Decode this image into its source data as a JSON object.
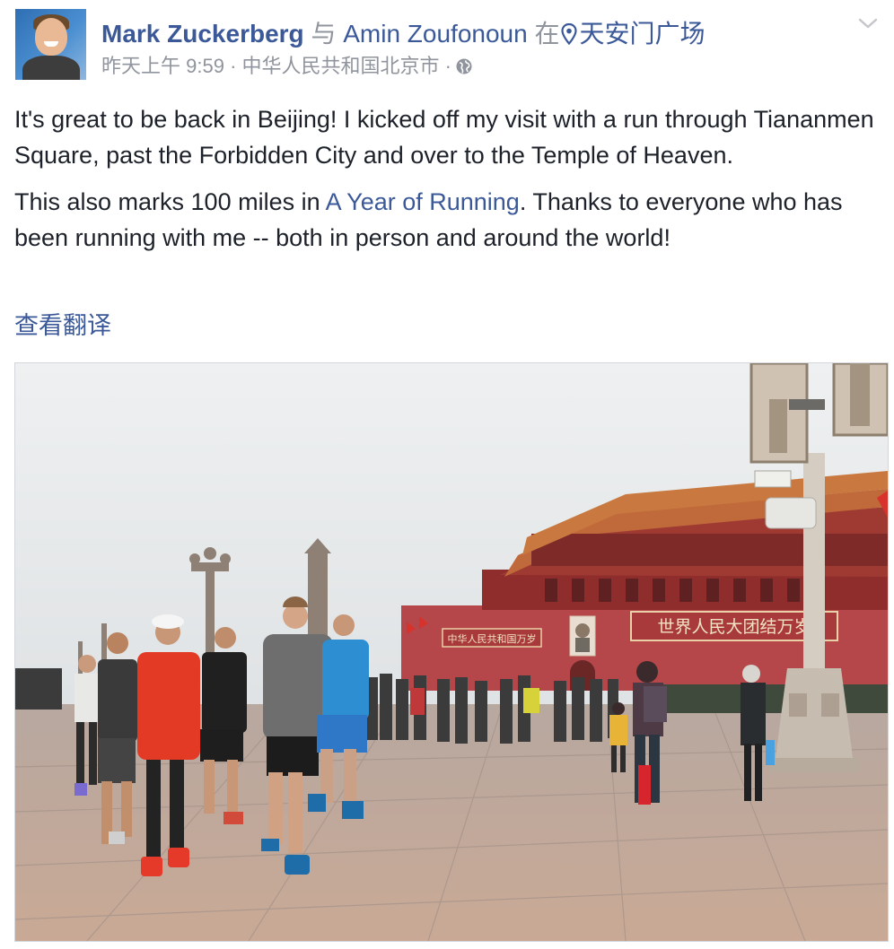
{
  "post": {
    "author": "Mark Zuckerberg",
    "with_word": "与",
    "tagged_user": "Amin Zoufonoun",
    "at_word": "在",
    "place": "天安门广场",
    "time": "昨天上午 9:59",
    "separator": "·",
    "location": "中华人民共和国北京市",
    "audience_icon": "globe-icon",
    "menu_icon": "chevron-down-icon",
    "paragraph1": "It's great to be back in Beijing! I kicked off my visit with a run through Tiananmen Square, past the Forbidden City and over to the Temple of Heaven.",
    "paragraph2_before": "This also marks 100 miles in ",
    "paragraph2_link": "A Year of Running",
    "paragraph2_after": ". Thanks to everyone who has been running with me -- both in person and around the world!",
    "translate": "查看翻译"
  },
  "photo": {
    "banner_text": "世界人民大团结万岁",
    "left_banner_text": "中华人民共和国万岁"
  },
  "colors": {
    "link": "#3b5998",
    "meta": "#90949c",
    "text": "#1d2129"
  }
}
